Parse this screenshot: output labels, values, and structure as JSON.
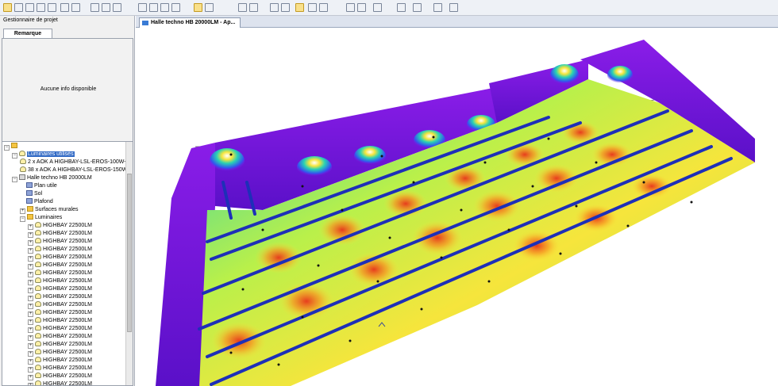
{
  "project_manager": {
    "title": "Gestionnaire de projet",
    "tab_label": "Remarque",
    "info_text": "Aucune info disponible"
  },
  "document_tab": {
    "label": "Halle techno HB 20000LM - Ap..."
  },
  "tree": {
    "used_luminaires": "Luminaires utilisés",
    "lum_type_1": "2 x AOK A HIGHBAY-LSL-EROS-100W-...",
    "lum_type_2": "38 x AOK A HIGHBAY-LSL-EROS-150W",
    "room": "Halle techno HB 20000LM",
    "plan_utile": "Plan utile",
    "sol": "Sol",
    "plafond": "Plafond",
    "surfaces_murales": "Surfaces murales",
    "luminaires": "Luminaires",
    "luminaire_item": "HIGHBAY 22500LM"
  },
  "colors": {
    "falsecolor_high": "#e8331b",
    "falsecolor_mid": "#f6e53c",
    "falsecolor_low": "#28d1b5",
    "falsecolor_min": "#7a1ee6",
    "luminaire_row": "#1e2fb8"
  }
}
